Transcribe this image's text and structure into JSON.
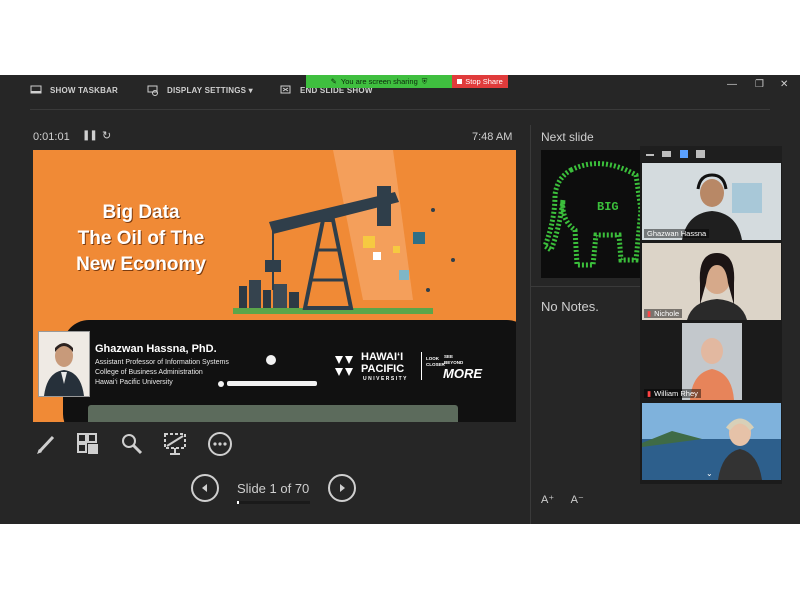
{
  "toolbar": {
    "show_taskbar": "SHOW TASKBAR",
    "display_settings": "DISPLAY SETTINGS ▾",
    "end_slide_show": "END SLIDE SHOW"
  },
  "share_banner": {
    "status": "You are screen sharing",
    "stop_label": "Stop Share",
    "color": "#3fbf3f",
    "stop_color": "#e03b3b"
  },
  "window_controls": {
    "minimize": "—",
    "restore": "❐",
    "close": "✕"
  },
  "presenter": {
    "timer": "0:01:01",
    "pause_icon": "pause-icon",
    "restart_icon": "restart-icon",
    "clock": "7:48 AM"
  },
  "slide": {
    "title_lines": [
      "Big Data",
      "The Oil of The",
      "New Economy"
    ],
    "speaker_name": "Ghazwan Hassna, PhD.",
    "speaker_lines": [
      "Assistant Professor of Information Systems",
      "College of Business Administration",
      "Hawai‘i Pacific University"
    ],
    "logo": [
      "HAWAI‘I",
      "PACIFIC",
      "UNIVERSITY"
    ],
    "logo_side": [
      "LOOK",
      "CLOSER"
    ],
    "logo_more": "MORE",
    "logo_small": [
      "SEE",
      "BEYOND"
    ],
    "bg_color": "#f08a36"
  },
  "tools": [
    "pen-icon",
    "grid-icon",
    "magnifier-icon",
    "subtitles-icon",
    "more-icon"
  ],
  "navigation": {
    "slide_label": "Slide 1 of 70",
    "progress": 0.014,
    "prev_icon": "prev-slide-icon",
    "next_icon": "next-slide-icon"
  },
  "sidebar": {
    "next_slide_label": "Next slide",
    "next_slide_thumb_text": "BIG",
    "notes": "No Notes.",
    "font_increase": "A⁺",
    "font_decrease": "A⁻"
  },
  "participants": [
    {
      "name": "Ghazwan Hassna",
      "muted": false,
      "bg": "#cfd6d8"
    },
    {
      "name": "Nichole",
      "muted": true,
      "bg": "#d9d2c8"
    },
    {
      "name": "William Rhey",
      "muted": true,
      "bg": "#c2c7cc"
    },
    {
      "name": "",
      "muted": false,
      "bg": "#6e9ec4"
    }
  ]
}
